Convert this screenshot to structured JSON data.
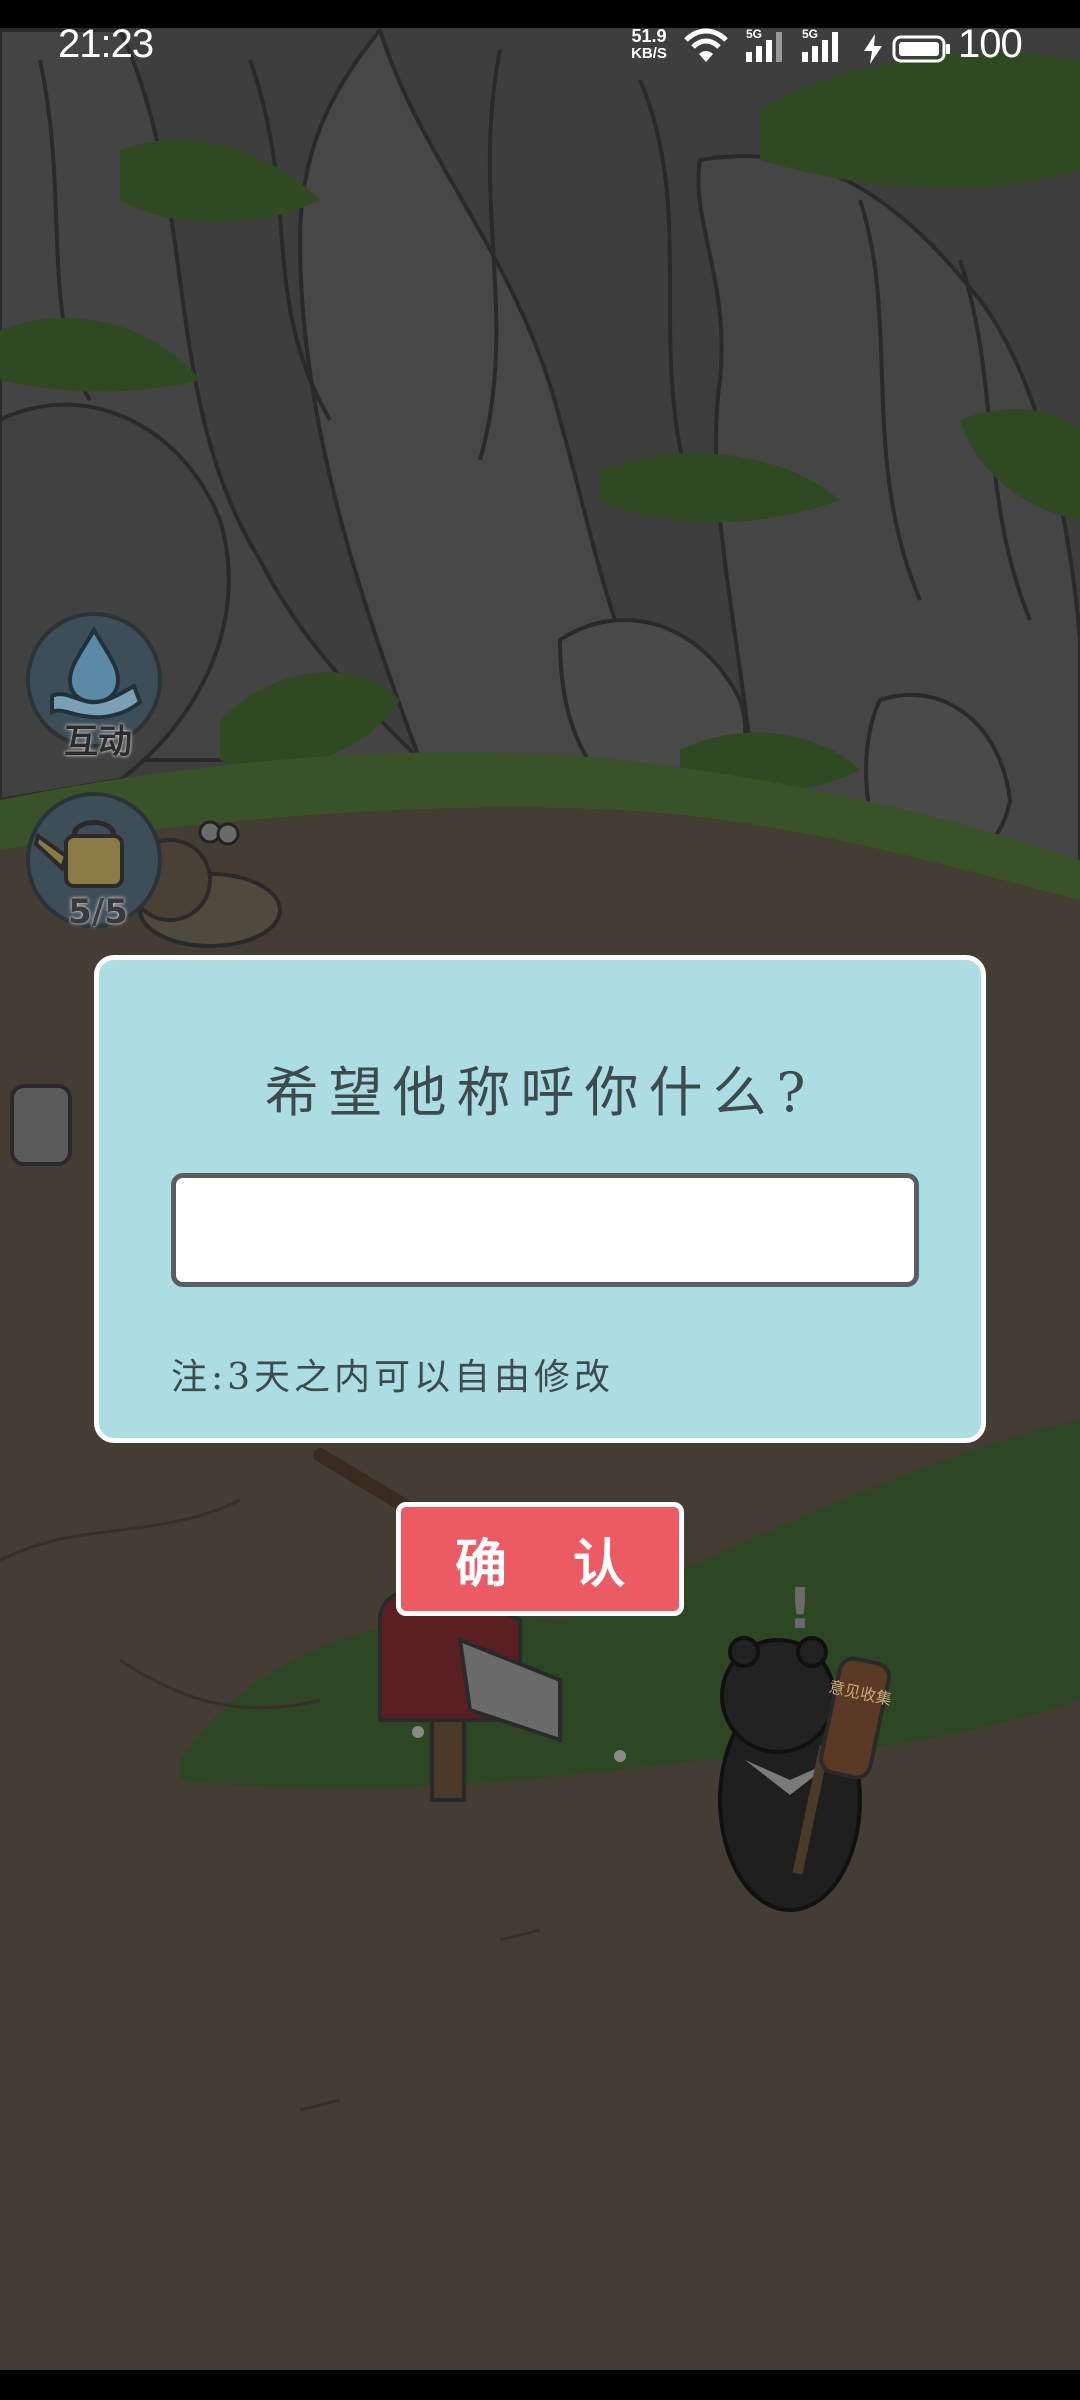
{
  "status_bar": {
    "time": "21:23",
    "net_speed_value": "51.9",
    "net_speed_unit": "KB/S",
    "signal_1_label": "5G",
    "signal_2_label": "5G",
    "battery_level": "100",
    "icons": [
      "wifi-icon",
      "signal-icon",
      "signal-icon",
      "charging-icon",
      "battery-icon"
    ]
  },
  "side_buttons": [
    {
      "name": "interact",
      "label": "互动",
      "icon": "water-drop-hand-icon"
    },
    {
      "name": "watering",
      "label": "5/5",
      "icon": "watering-can-icon"
    }
  ],
  "dialog": {
    "title": "希望他称呼你什么?",
    "input_value": "",
    "note": "注:3天之内可以自由修改",
    "confirm_label": "确 认"
  },
  "scene": {
    "bear_sign_text": "意见收集",
    "exclamation": "!"
  },
  "colors": {
    "dialog_bg": "#acdde3",
    "dialog_border": "#ffffff",
    "confirm_bg": "#ec5b64",
    "text_dark": "#3d4a4e"
  }
}
